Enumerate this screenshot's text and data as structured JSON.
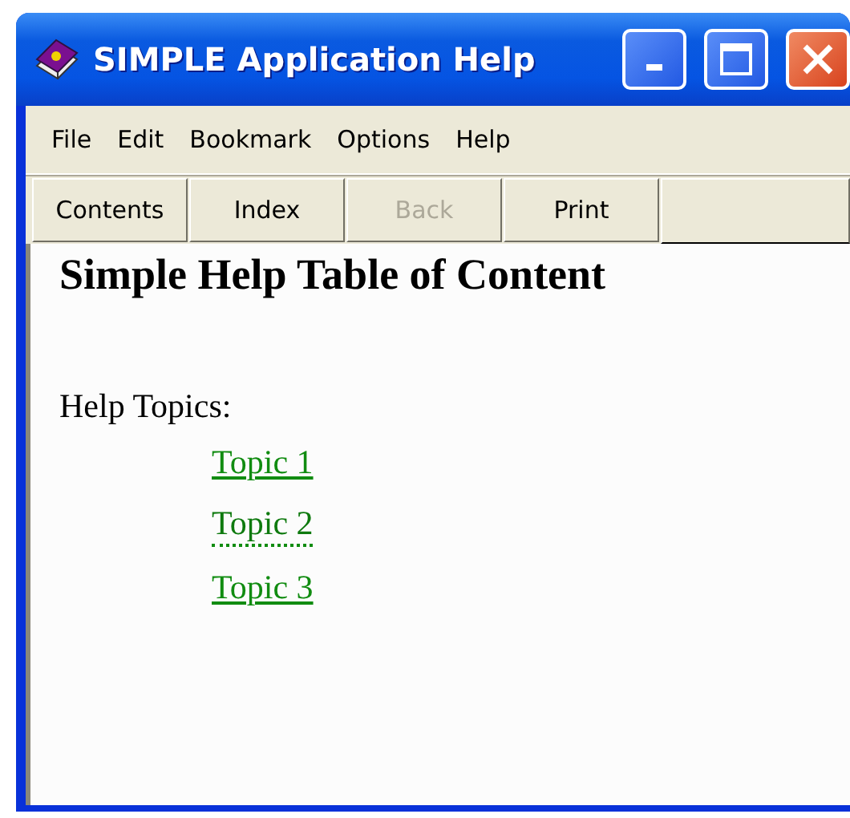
{
  "window": {
    "title": "SIMPLE Application Help"
  },
  "menu": [
    {
      "label": "File"
    },
    {
      "label": "Edit"
    },
    {
      "label": "Bookmark"
    },
    {
      "label": "Options"
    },
    {
      "label": "Help"
    }
  ],
  "toolbar": [
    {
      "label": "Contents",
      "disabled": false
    },
    {
      "label": "Index",
      "disabled": false
    },
    {
      "label": "Back",
      "disabled": true
    },
    {
      "label": "Print",
      "disabled": false
    }
  ],
  "content": {
    "heading": "Simple Help Table of Content",
    "intro": "Help Topics:",
    "links": [
      {
        "label": "Topic 1",
        "focused": false
      },
      {
        "label": "Topic 2",
        "focused": true
      },
      {
        "label": "Topic 3",
        "focused": false
      }
    ]
  }
}
